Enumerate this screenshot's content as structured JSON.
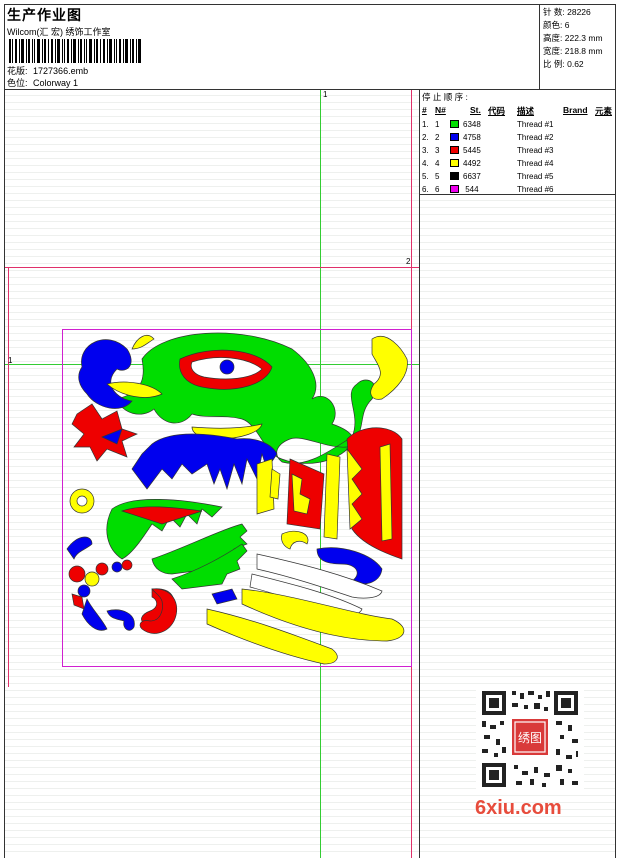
{
  "header": {
    "title": "生产作业图",
    "company": "Wilcom(汇 宏) 绣饰工作室",
    "design_label": "花版:",
    "design_file": "1727366.emb",
    "colorway_label": "色位:",
    "colorway": "Colorway 1"
  },
  "stats": [
    {
      "label": "针 数:",
      "value": "28226"
    },
    {
      "label": "颜色:",
      "value": "6"
    },
    {
      "label": "高度:",
      "value": "222.3 mm"
    },
    {
      "label": "宽度:",
      "value": "218.8 mm"
    },
    {
      "label": "比 例:",
      "value": "0.62"
    }
  ],
  "canvas": {
    "marker_1": "1",
    "marker_2": "2"
  },
  "stop_sequence": {
    "title": "停 止 顺 序 :",
    "headers": {
      "num": "#",
      "n": "N#",
      "st": "St.",
      "code": "代码",
      "desc": "描述",
      "brand": "Brand",
      "element": "元素"
    },
    "rows": [
      {
        "idx": "1.",
        "n": "1",
        "color": "#00dd00",
        "code": "6348",
        "desc": "Thread #1"
      },
      {
        "idx": "2.",
        "n": "2",
        "color": "#0000ee",
        "code": "4758",
        "desc": "Thread #2"
      },
      {
        "idx": "3.",
        "n": "3",
        "color": "#ee0000",
        "code": "5445",
        "desc": "Thread #3"
      },
      {
        "idx": "4.",
        "n": "4",
        "color": "#ffff00",
        "code": "4492",
        "desc": "Thread #4"
      },
      {
        "idx": "5.",
        "n": "5",
        "color": "#000000",
        "code": "6637",
        "desc": "Thread #5"
      },
      {
        "idx": "6.",
        "n": "6",
        "color": "#ee00ee",
        "code": " 544",
        "desc": "Thread #6"
      }
    ]
  },
  "watermark": {
    "site": "6xiu.com",
    "stamp": "绣图"
  }
}
